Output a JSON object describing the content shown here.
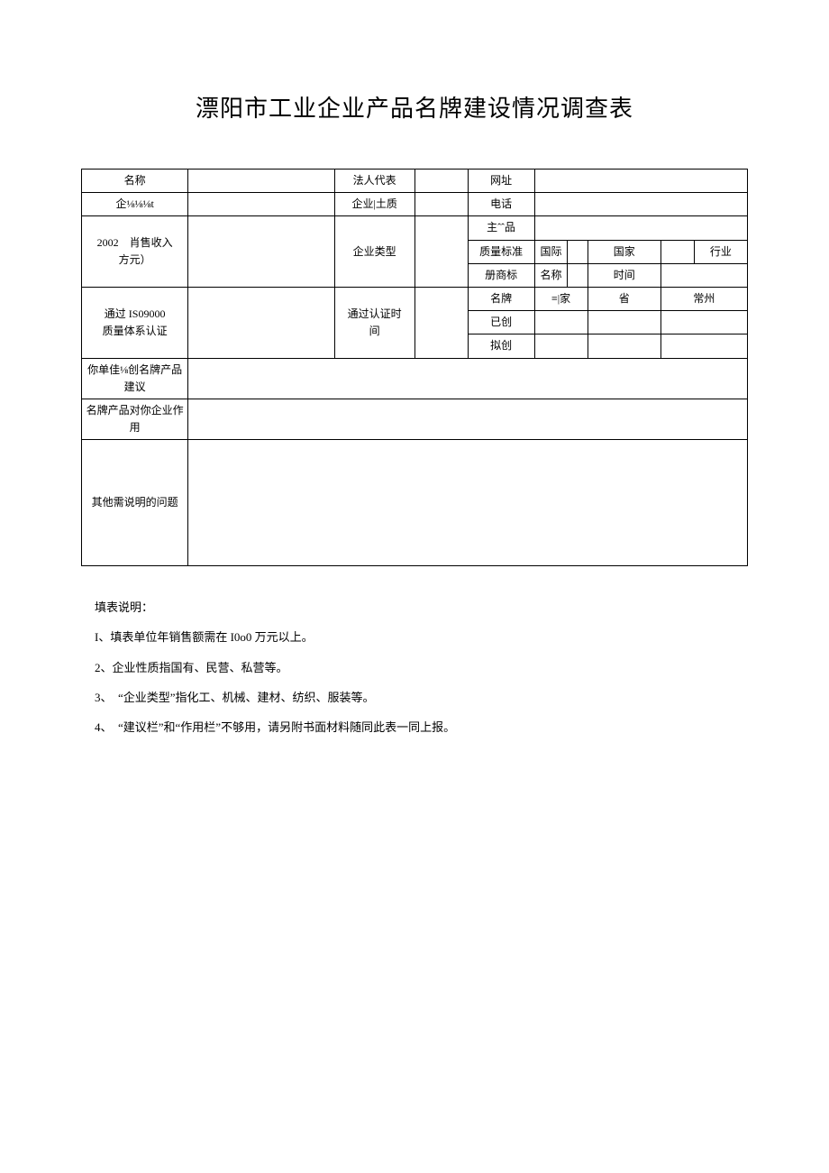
{
  "title": "漂阳市工业企业产品名牌建设情况调查表",
  "labels": {
    "name": "名称",
    "legal_rep": "法人代表",
    "website": "网址",
    "company_code": "企⅛⅛⅛t",
    "nature": "企业|土质",
    "phone": "电话",
    "sales_2002": "2002　肖售收入\n方元）",
    "type": "企业类型",
    "main_product": "主ˆˆ品",
    "quality_std": "质量标准",
    "intl": "国际",
    "national": "国家",
    "industry": "行业",
    "reg_trademark": "册商标",
    "tm_name": "名称",
    "tm_time": "时间",
    "iso": "通过 IS09000\n质量体系认证",
    "cert_time": "通过认证时\n间",
    "mingpai": "名牌",
    "level_national": "≡|家",
    "level_province": "省",
    "level_changzhou": "常州",
    "yichuang": "已创",
    "nichuang": "拟创",
    "suggestion": "你单佳⅛创名牌产品\n建议",
    "effect": "名牌产品对你企业作\n用",
    "other": "其他需说明的问题"
  },
  "notes": {
    "intro": "填表说明：",
    "n1": "I、填表单位年销售额需在 I0o0 万元以上。",
    "n2": "2、企业性质指国有、民营、私营等。",
    "n3": "3、　“企业类型”指化工、机械、建材、纺织、服装等。",
    "n4": "4、　“建议栏”和“作用栏”不够用，请另附书面材料随同此表一同上报。"
  }
}
